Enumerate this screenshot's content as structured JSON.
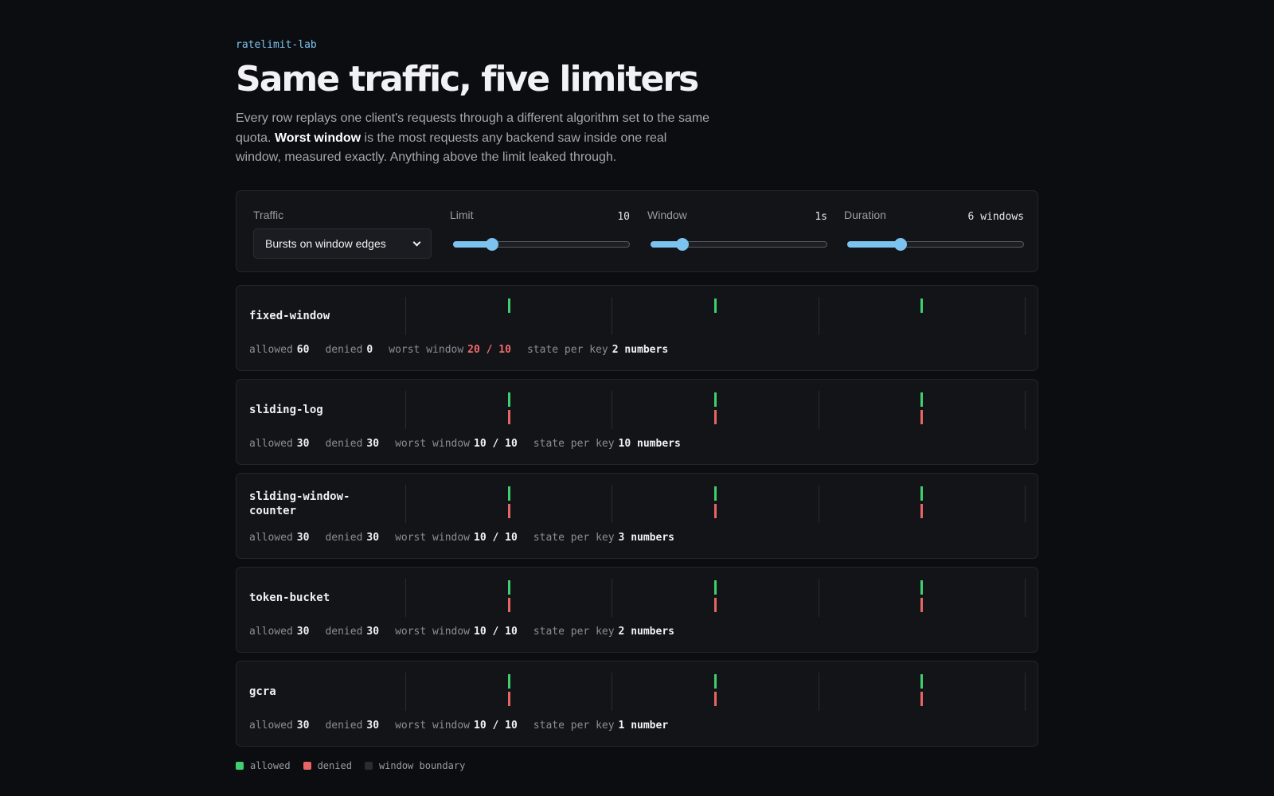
{
  "header": {
    "kicker": "ratelimit-lab",
    "title": "Same traffic, five limiters",
    "lede_pre": "Every row replays one client's requests through a different algorithm set to the same quota.",
    "lede_bold": "Worst window",
    "lede_post": "is the most requests any backend saw inside one real window, measured exactly. Anything above the limit leaked through."
  },
  "controls": {
    "traffic": {
      "label": "Traffic",
      "selected": "Bursts on window edges"
    },
    "limit": {
      "label": "Limit",
      "value": "10",
      "level": 0.22
    },
    "window": {
      "label": "Window",
      "value": "1s",
      "level": 0.18
    },
    "duration": {
      "label": "Duration",
      "value": "6 windows",
      "level": 0.3
    }
  },
  "labels": {
    "allowed": "allowed",
    "denied": "denied",
    "worst_window": "worst window",
    "state_per_key": "state per key"
  },
  "timeline": {
    "windows_shown": 3,
    "burst_positions": [
      0.5,
      1.5,
      2.5
    ]
  },
  "rows": [
    {
      "name": "fixed-window",
      "allowed": "60",
      "denied": "0",
      "worst": "20 / 10",
      "worst_leaked": true,
      "state": "2 numbers",
      "has_denied": false
    },
    {
      "name": "sliding-log",
      "allowed": "30",
      "denied": "30",
      "worst": "10 / 10",
      "worst_leaked": false,
      "state": "10 numbers",
      "has_denied": true
    },
    {
      "name": "sliding-window-counter",
      "allowed": "30",
      "denied": "30",
      "worst": "10 / 10",
      "worst_leaked": false,
      "state": "3 numbers",
      "has_denied": true
    },
    {
      "name": "token-bucket",
      "allowed": "30",
      "denied": "30",
      "worst": "10 / 10",
      "worst_leaked": false,
      "state": "2 numbers",
      "has_denied": true
    },
    {
      "name": "gcra",
      "allowed": "30",
      "denied": "30",
      "worst": "10 / 10",
      "worst_leaked": false,
      "state": "1 number",
      "has_denied": true
    }
  ],
  "legend": [
    {
      "label": "allowed",
      "color": "#3fcf6e"
    },
    {
      "label": "denied",
      "color": "#e66565"
    },
    {
      "label": "window boundary",
      "color": "#2a2c32"
    }
  ],
  "colors": {
    "accent": "#7cc4ef",
    "allowed": "#3fcf6e",
    "denied": "#e66565",
    "leak": "#f06b6b"
  }
}
